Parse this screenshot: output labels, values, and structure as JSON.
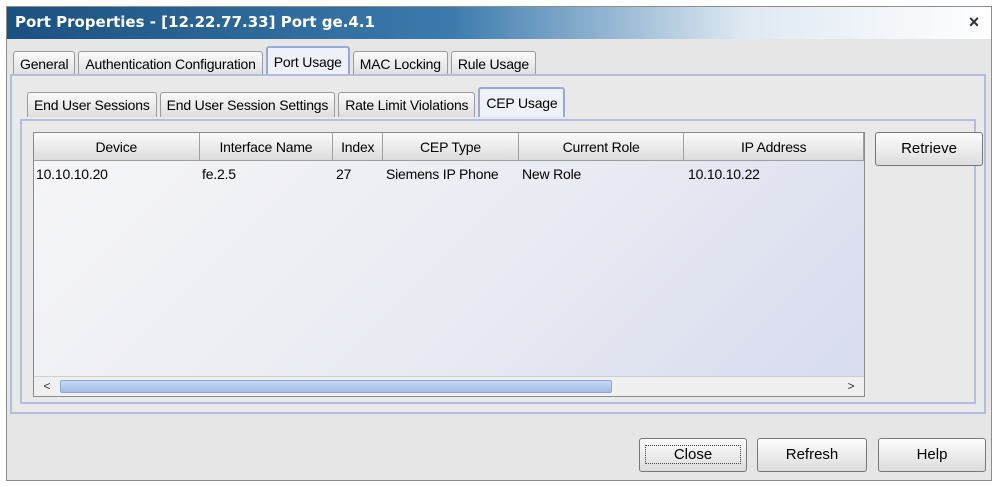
{
  "window": {
    "title": "Port Properties - [12.22.77.33] Port ge.4.1",
    "close_glyph": "×"
  },
  "tabs": [
    "General",
    "Authentication Configuration",
    "Port Usage",
    "MAC Locking",
    "Rule Usage"
  ],
  "subtabs": [
    "End User Sessions",
    "End User Session Settings",
    "Rate Limit Violations",
    "CEP Usage"
  ],
  "table": {
    "columns": [
      "Device",
      "Interface Name",
      "Index",
      "CEP Type",
      "Current Role",
      "IP Address"
    ],
    "rows": [
      [
        "10.10.10.20",
        "fe.2.5",
        "27",
        "Siemens IP Phone",
        "New Role",
        "10.10.10.22"
      ]
    ]
  },
  "scroll": {
    "left_arrow": "<",
    "right_arrow": ">"
  },
  "buttons": {
    "retrieve": "Retrieve",
    "close": "Close",
    "refresh": "Refresh",
    "help": "Help"
  }
}
